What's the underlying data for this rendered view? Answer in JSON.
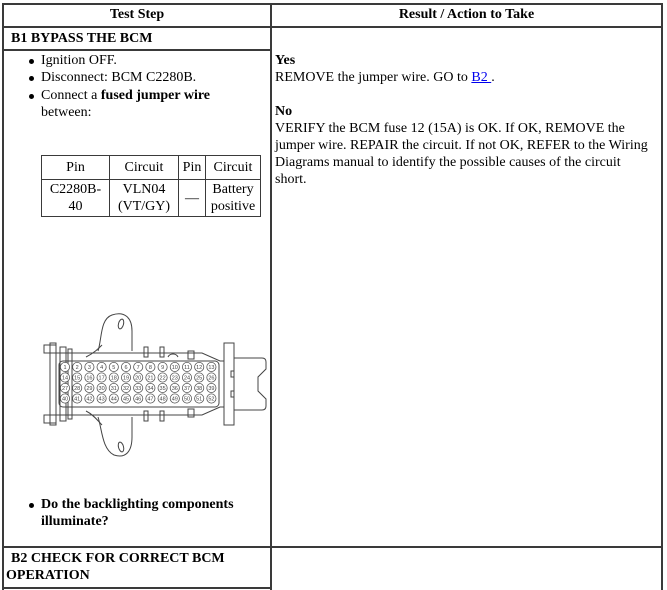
{
  "table": {
    "headers": {
      "test_step": "Test Step",
      "result": "Result / Action to Take"
    },
    "steps": [
      {
        "id": "B1",
        "title": "B1 BYPASS THE BCM",
        "instructions": [
          "Ignition OFF.",
          "Disconnect: BCM C2280B.",
          {
            "prefix": "Connect a ",
            "bold": "fused jumper wire",
            "suffix": "between:"
          }
        ],
        "pin_table": {
          "columns": [
            "Pin",
            "Circuit",
            "Pin",
            "Circuit"
          ],
          "rows": [
            [
              "C2280B-40",
              "VLN04 (VT/GY)",
              "—",
              "Battery positive"
            ]
          ]
        },
        "connector_figure": {
          "name": "BCM C2280B connector",
          "pin_rows": [
            [
              "1",
              "2",
              "3",
              "4",
              "5",
              "6",
              "7",
              "8",
              "9",
              "10",
              "11",
              "12",
              "13"
            ],
            [
              "14",
              "15",
              "16",
              "17",
              "18",
              "19",
              "20",
              "21",
              "22",
              "23",
              "24",
              "25",
              "26"
            ],
            [
              "27",
              "28",
              "29",
              "30",
              "31",
              "32",
              "33",
              "34",
              "35",
              "36",
              "37",
              "38",
              "39"
            ],
            [
              "40",
              "41",
              "42",
              "43",
              "44",
              "45",
              "46",
              "47",
              "48",
              "49",
              "50",
              "51",
              "52"
            ]
          ]
        },
        "question": "Do the backlighting components illuminate?",
        "results": {
          "yes": {
            "label": "Yes",
            "text_before_link": "REMOVE the jumper wire. GO to ",
            "link": "B2 ",
            "text_after_link": "."
          },
          "no": {
            "label": "No",
            "lines": [
              "VERIFY the BCM fuse 12 (15A) is OK. If OK, REMOVE the",
              "jumper wire. REPAIR the circuit. If not OK, REFER to the Wiring",
              "Diagrams manual to identify the possible causes of the circuit",
              "short."
            ]
          }
        }
      },
      {
        "id": "B2",
        "title_lines": [
          "B2 CHECK FOR CORRECT BCM",
          "OPERATION"
        ]
      }
    ]
  }
}
